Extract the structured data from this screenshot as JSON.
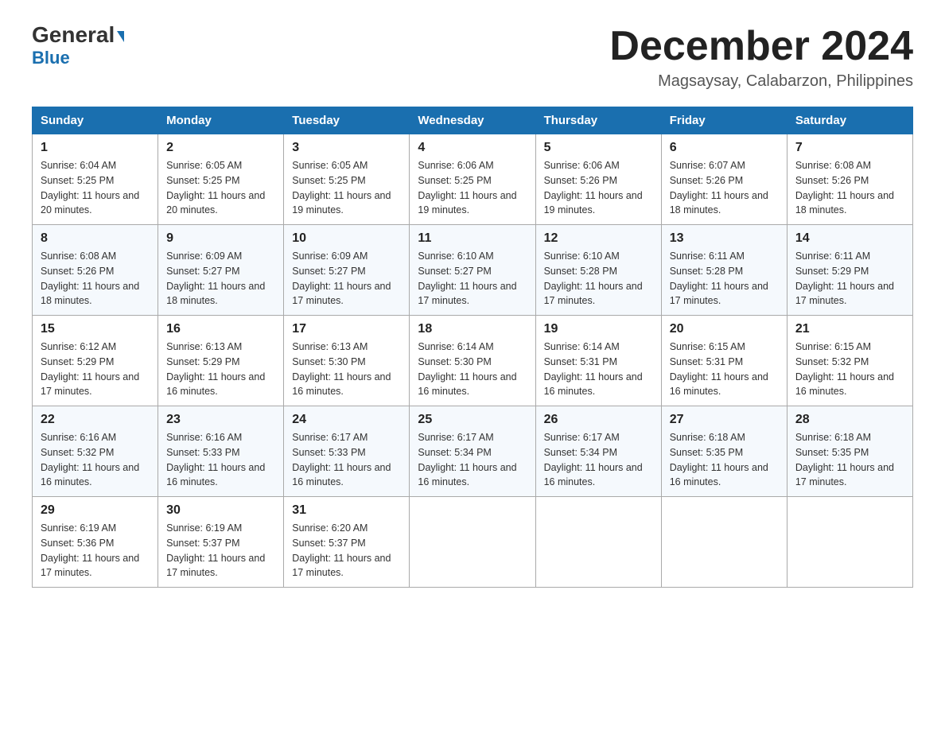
{
  "header": {
    "logo_general": "General",
    "logo_blue": "Blue",
    "month_title": "December 2024",
    "location": "Magsaysay, Calabarzon, Philippines"
  },
  "days_of_week": [
    "Sunday",
    "Monday",
    "Tuesday",
    "Wednesday",
    "Thursday",
    "Friday",
    "Saturday"
  ],
  "weeks": [
    [
      {
        "day": "1",
        "sunrise": "6:04 AM",
        "sunset": "5:25 PM",
        "daylight": "11 hours and 20 minutes."
      },
      {
        "day": "2",
        "sunrise": "6:05 AM",
        "sunset": "5:25 PM",
        "daylight": "11 hours and 20 minutes."
      },
      {
        "day": "3",
        "sunrise": "6:05 AM",
        "sunset": "5:25 PM",
        "daylight": "11 hours and 19 minutes."
      },
      {
        "day": "4",
        "sunrise": "6:06 AM",
        "sunset": "5:25 PM",
        "daylight": "11 hours and 19 minutes."
      },
      {
        "day": "5",
        "sunrise": "6:06 AM",
        "sunset": "5:26 PM",
        "daylight": "11 hours and 19 minutes."
      },
      {
        "day": "6",
        "sunrise": "6:07 AM",
        "sunset": "5:26 PM",
        "daylight": "11 hours and 18 minutes."
      },
      {
        "day": "7",
        "sunrise": "6:08 AM",
        "sunset": "5:26 PM",
        "daylight": "11 hours and 18 minutes."
      }
    ],
    [
      {
        "day": "8",
        "sunrise": "6:08 AM",
        "sunset": "5:26 PM",
        "daylight": "11 hours and 18 minutes."
      },
      {
        "day": "9",
        "sunrise": "6:09 AM",
        "sunset": "5:27 PM",
        "daylight": "11 hours and 18 minutes."
      },
      {
        "day": "10",
        "sunrise": "6:09 AM",
        "sunset": "5:27 PM",
        "daylight": "11 hours and 17 minutes."
      },
      {
        "day": "11",
        "sunrise": "6:10 AM",
        "sunset": "5:27 PM",
        "daylight": "11 hours and 17 minutes."
      },
      {
        "day": "12",
        "sunrise": "6:10 AM",
        "sunset": "5:28 PM",
        "daylight": "11 hours and 17 minutes."
      },
      {
        "day": "13",
        "sunrise": "6:11 AM",
        "sunset": "5:28 PM",
        "daylight": "11 hours and 17 minutes."
      },
      {
        "day": "14",
        "sunrise": "6:11 AM",
        "sunset": "5:29 PM",
        "daylight": "11 hours and 17 minutes."
      }
    ],
    [
      {
        "day": "15",
        "sunrise": "6:12 AM",
        "sunset": "5:29 PM",
        "daylight": "11 hours and 17 minutes."
      },
      {
        "day": "16",
        "sunrise": "6:13 AM",
        "sunset": "5:29 PM",
        "daylight": "11 hours and 16 minutes."
      },
      {
        "day": "17",
        "sunrise": "6:13 AM",
        "sunset": "5:30 PM",
        "daylight": "11 hours and 16 minutes."
      },
      {
        "day": "18",
        "sunrise": "6:14 AM",
        "sunset": "5:30 PM",
        "daylight": "11 hours and 16 minutes."
      },
      {
        "day": "19",
        "sunrise": "6:14 AM",
        "sunset": "5:31 PM",
        "daylight": "11 hours and 16 minutes."
      },
      {
        "day": "20",
        "sunrise": "6:15 AM",
        "sunset": "5:31 PM",
        "daylight": "11 hours and 16 minutes."
      },
      {
        "day": "21",
        "sunrise": "6:15 AM",
        "sunset": "5:32 PM",
        "daylight": "11 hours and 16 minutes."
      }
    ],
    [
      {
        "day": "22",
        "sunrise": "6:16 AM",
        "sunset": "5:32 PM",
        "daylight": "11 hours and 16 minutes."
      },
      {
        "day": "23",
        "sunrise": "6:16 AM",
        "sunset": "5:33 PM",
        "daylight": "11 hours and 16 minutes."
      },
      {
        "day": "24",
        "sunrise": "6:17 AM",
        "sunset": "5:33 PM",
        "daylight": "11 hours and 16 minutes."
      },
      {
        "day": "25",
        "sunrise": "6:17 AM",
        "sunset": "5:34 PM",
        "daylight": "11 hours and 16 minutes."
      },
      {
        "day": "26",
        "sunrise": "6:17 AM",
        "sunset": "5:34 PM",
        "daylight": "11 hours and 16 minutes."
      },
      {
        "day": "27",
        "sunrise": "6:18 AM",
        "sunset": "5:35 PM",
        "daylight": "11 hours and 16 minutes."
      },
      {
        "day": "28",
        "sunrise": "6:18 AM",
        "sunset": "5:35 PM",
        "daylight": "11 hours and 17 minutes."
      }
    ],
    [
      {
        "day": "29",
        "sunrise": "6:19 AM",
        "sunset": "5:36 PM",
        "daylight": "11 hours and 17 minutes."
      },
      {
        "day": "30",
        "sunrise": "6:19 AM",
        "sunset": "5:37 PM",
        "daylight": "11 hours and 17 minutes."
      },
      {
        "day": "31",
        "sunrise": "6:20 AM",
        "sunset": "5:37 PM",
        "daylight": "11 hours and 17 minutes."
      },
      null,
      null,
      null,
      null
    ]
  ],
  "labels": {
    "sunrise": "Sunrise:",
    "sunset": "Sunset:",
    "daylight": "Daylight:"
  }
}
